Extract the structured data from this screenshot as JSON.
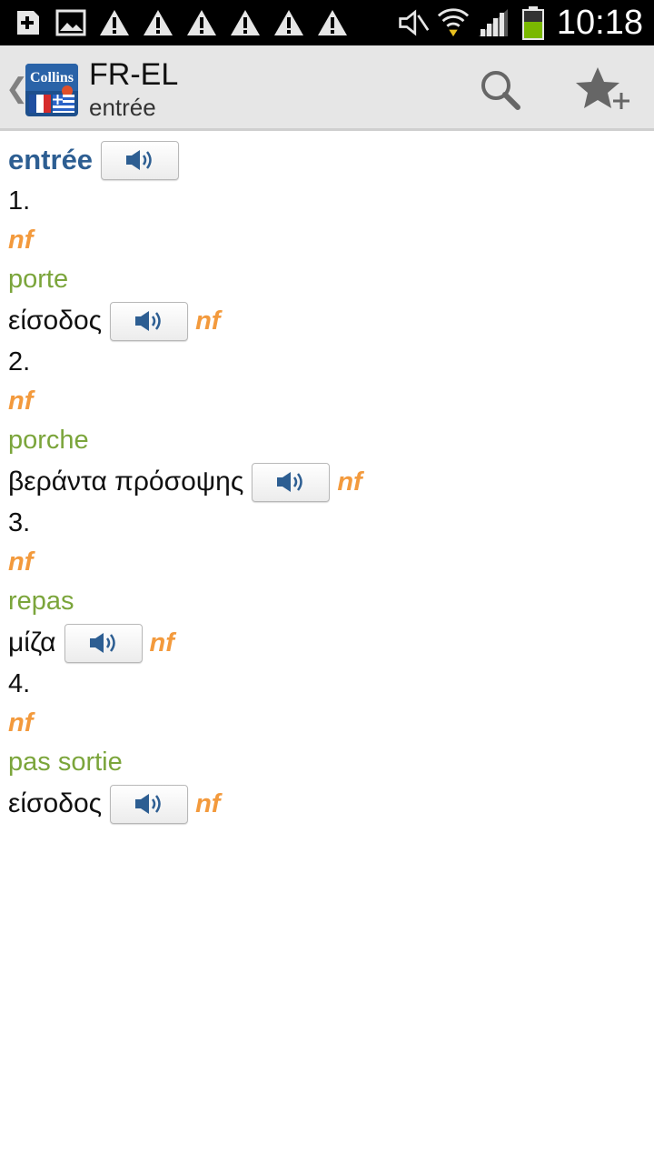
{
  "status_bar": {
    "time": "10:18",
    "left_icons": [
      "add-icon",
      "image-icon",
      "warning-icon",
      "warning-icon",
      "warning-icon",
      "warning-icon",
      "warning-icon",
      "warning-icon"
    ],
    "right_icons": [
      "mute-icon",
      "wifi-icon",
      "signal-icon",
      "battery-icon"
    ]
  },
  "action_bar": {
    "title": "FR-EL",
    "subtitle": "entrée",
    "logo_text": "Collins"
  },
  "entry": {
    "headword": "entrée",
    "senses": [
      {
        "number": "1.",
        "pos": "nf",
        "source": "porte",
        "translation": "είσοδος",
        "translation_pos": "nf"
      },
      {
        "number": "2.",
        "pos": "nf",
        "source": "porche",
        "translation": "βεράντα πρόσοψης",
        "translation_pos": "nf"
      },
      {
        "number": "3.",
        "pos": "nf",
        "source": "repas",
        "translation": "μίζα",
        "translation_pos": "nf"
      },
      {
        "number": "4.",
        "pos": "nf",
        "source": "pas sortie",
        "translation": "είσοδος",
        "translation_pos": "nf"
      }
    ]
  },
  "colors": {
    "headword": "#2d5e92",
    "part_of_speech": "#f39a3d",
    "source_word": "#7ba53b",
    "action_bar_bg": "#e6e6e6"
  }
}
